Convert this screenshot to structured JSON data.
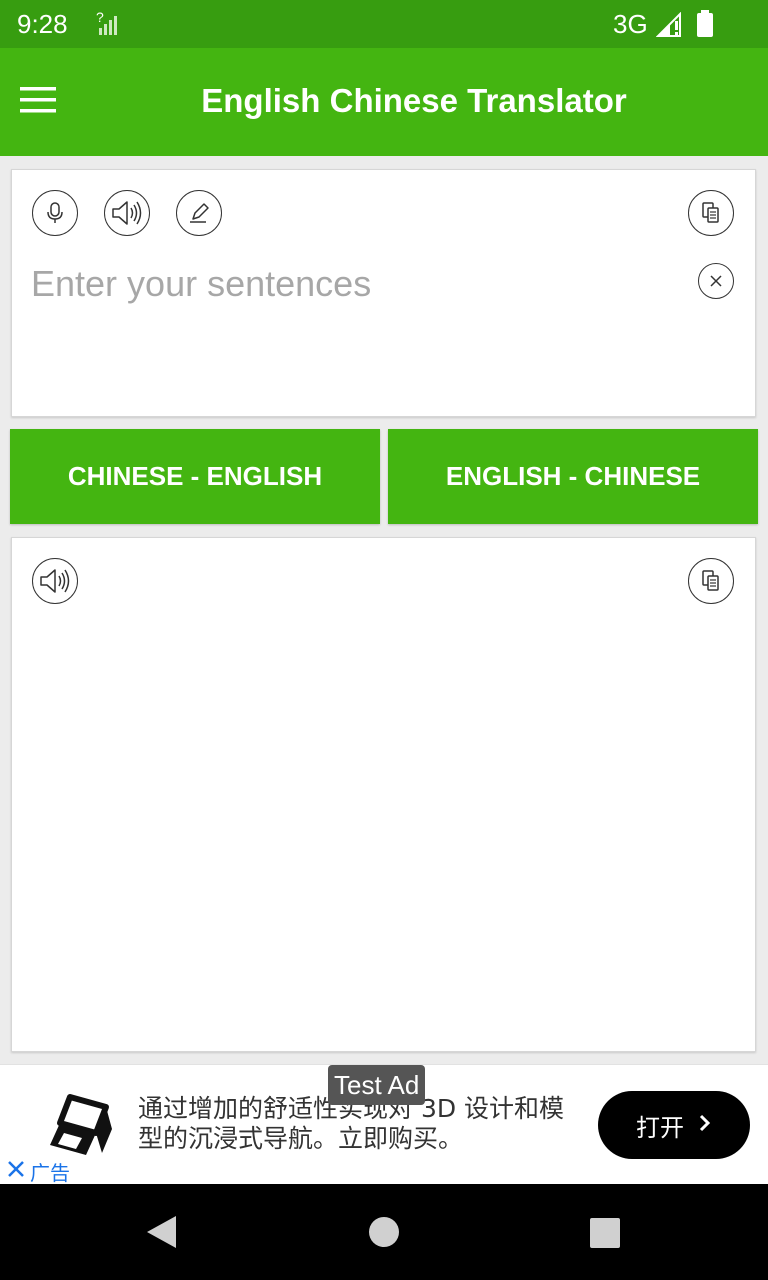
{
  "status_bar": {
    "time": "9:28",
    "network": "3G",
    "sim_icon": "no-sim-signal-icon",
    "signal_icon": "cell-signal-icon",
    "battery_icon": "battery-icon"
  },
  "app_bar": {
    "title": "English Chinese Translator",
    "menu_icon": "hamburger-menu-icon"
  },
  "input_card": {
    "placeholder": "Enter your sentences",
    "value": "",
    "icons": [
      "microphone-icon",
      "speaker-icon",
      "pen-icon",
      "copy-icon",
      "clear-icon"
    ]
  },
  "language_buttons": {
    "chinese_english": "CHINESE - ENGLISH",
    "english_chinese": "ENGLISH - CHINESE"
  },
  "output_card": {
    "text": "",
    "icons": [
      "speaker-icon",
      "copy-icon"
    ]
  },
  "ad": {
    "label": "Test Ad",
    "text": "通过增加的舒适性实现对 3D 设计和模型的沉浸式导航。立即购买。",
    "cta": "打开",
    "close_label": "广告"
  },
  "nav_bar": {
    "icons": [
      "back-icon",
      "home-icon",
      "recent-apps-icon"
    ]
  },
  "colors": {
    "status_bar": "#379d10",
    "app_bar": "#44b511",
    "accent": "#44b511",
    "placeholder": "#a7a7a7",
    "background": "#ececec"
  }
}
